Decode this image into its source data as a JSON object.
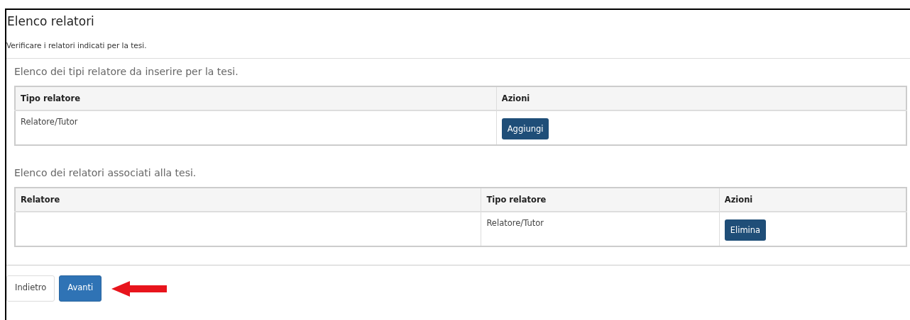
{
  "title": "Elenco relatori",
  "subtitle": "Verificare i relatori indicati per la tesi.",
  "sections": [
    {
      "heading": "Elenco dei tipi relatore da inserire per la tesi.",
      "columns": [
        "Tipo relatore",
        "Azioni"
      ],
      "rows": [
        {
          "cells": [
            {
              "kind": "text",
              "text": "Relatore/Tutor"
            },
            {
              "kind": "button",
              "label": "Aggiungi"
            }
          ]
        }
      ]
    },
    {
      "heading": "Elenco dei relatori associati alla tesi.",
      "columns": [
        "Relatore",
        "Tipo relatore",
        "Azioni"
      ],
      "rows": [
        {
          "cells": [
            {
              "kind": "text",
              "text": ""
            },
            {
              "kind": "text",
              "text": "Relatore/Tutor"
            },
            {
              "kind": "button",
              "label": "Elimina"
            }
          ]
        }
      ]
    }
  ],
  "buttons": [
    {
      "label": "Indietro",
      "kind": "default"
    },
    {
      "label": "Avanti",
      "kind": "primary"
    }
  ]
}
